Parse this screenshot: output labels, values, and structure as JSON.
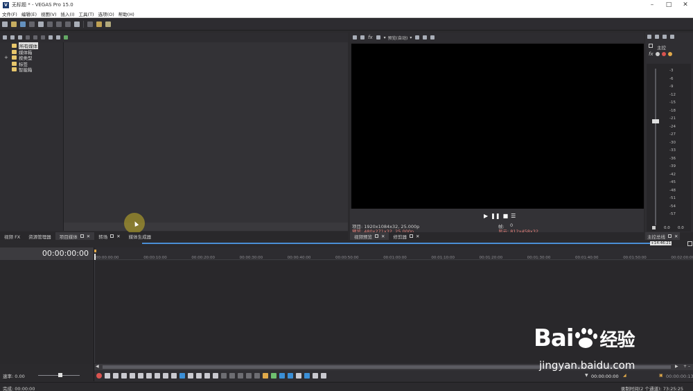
{
  "window": {
    "title": "无标题 * - VEGAS Pro 15.0",
    "app_icon": "V",
    "controls": [
      "minimize",
      "maximize",
      "close"
    ]
  },
  "menu": {
    "items": [
      "文件(F)",
      "编辑(E)",
      "视图(V)",
      "插入(I)",
      "工具(T)",
      "选项(O)",
      "帮助(H)"
    ]
  },
  "media_tree": {
    "items": [
      "所有媒体",
      "媒体箱",
      "按类型",
      "标签",
      "智能箱"
    ]
  },
  "left_tabs": [
    {
      "label": "视频 FX"
    },
    {
      "label": "资源管理器"
    },
    {
      "label": "项目媒体"
    },
    {
      "label": "转场"
    },
    {
      "label": "媒体生成器"
    }
  ],
  "preview": {
    "quality_label": "预览(自动)",
    "project_info": "项目: 1920x1084x32, 25.000p",
    "preview_info": "预览: 480x271x32, 25.000p",
    "frame_label": "帧:",
    "frame_value": "0",
    "display_info": "显示: 812x458x32",
    "tabs": [
      "视频预览",
      "修剪器"
    ]
  },
  "master_bus": {
    "label": "主控",
    "tab_label": "主控总线",
    "ticks": [
      "3",
      "6",
      "9",
      "12",
      "15",
      "18",
      "21",
      "24",
      "27",
      "30",
      "33",
      "36",
      "39",
      "42",
      "45",
      "48",
      "51",
      "54",
      "57"
    ],
    "left_value": "0.0",
    "right_value": "0.0",
    "fader_level": 0.38
  },
  "timeline": {
    "timecode": "00:00:00:00",
    "scroll_badge": "+14:46:21",
    "ruler": [
      "00:00:00:00",
      "00:00:10:00",
      "00:00:20:00",
      "00:00:30:00",
      "00:00:40:00",
      "00:00:50:00",
      "00:01:00:00",
      "00:01:10:00",
      "00:01:20:00",
      "00:01:30:00",
      "00:01:40:00",
      "00:01:50:00",
      "00:02:00:00"
    ],
    "rate_label": "速率: 0.00",
    "cursor_time": "00:00:00:00",
    "end_time": "00:00:00:13"
  },
  "status": {
    "left": "完成: 00:00:00",
    "right": "录制时间(2 个通道): 73:25:25"
  },
  "watermark": {
    "brand": "Bai",
    "brand_suffix": "经验",
    "url": "jingyan.baidu.com"
  }
}
